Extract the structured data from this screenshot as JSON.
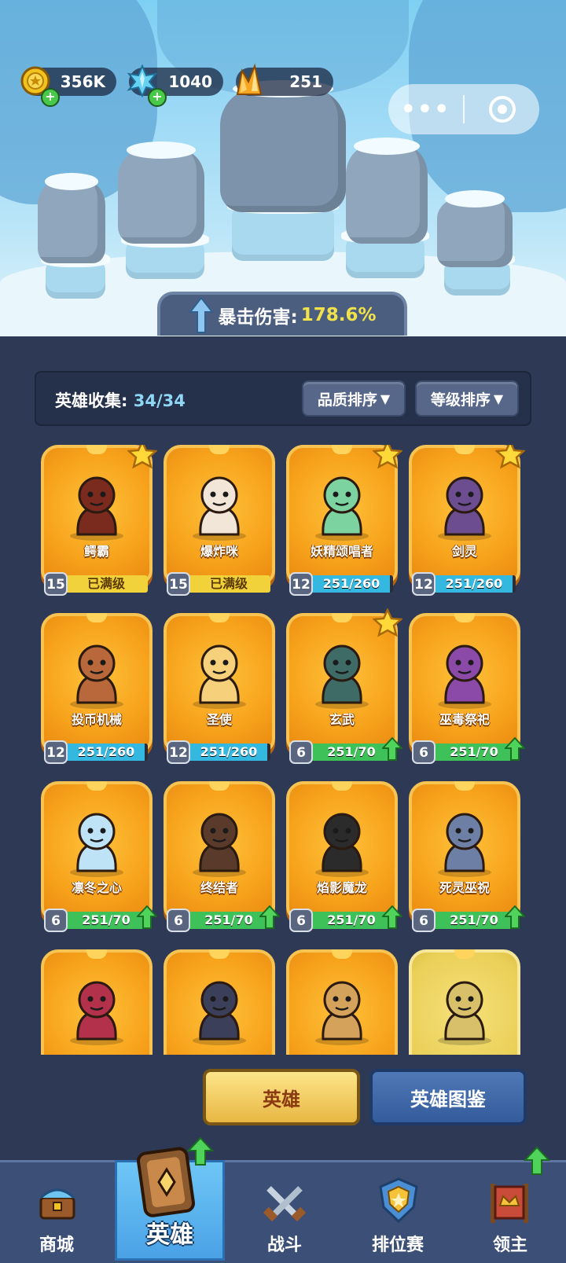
{
  "resources": [
    {
      "icon": "gold-coin-icon",
      "value": "356K"
    },
    {
      "icon": "blue-crystal-icon",
      "value": "1040"
    },
    {
      "icon": "orange-crystal-icon",
      "value": "251"
    }
  ],
  "crit": {
    "label": "暴击伤害:",
    "value": "178.6%"
  },
  "collection": {
    "label": "英雄收集:",
    "value": "34/34"
  },
  "sort": {
    "quality": "品质排序",
    "level": "等级排序"
  },
  "heroes": [
    {
      "name": "鳄霸",
      "level": "15",
      "progress": "已满级",
      "fill": 1.0,
      "maxed": true,
      "star": true,
      "upgrade": false
    },
    {
      "name": "爆炸咪",
      "level": "15",
      "progress": "已满级",
      "fill": 1.0,
      "maxed": true,
      "star": false,
      "upgrade": false
    },
    {
      "name": "妖精颂唱者",
      "level": "12",
      "progress": "251/260",
      "fill": 0.965,
      "maxed": false,
      "star": true,
      "upgrade": false
    },
    {
      "name": "剑灵",
      "level": "12",
      "progress": "251/260",
      "fill": 0.965,
      "maxed": false,
      "star": true,
      "upgrade": false
    },
    {
      "name": "投币机械",
      "level": "12",
      "progress": "251/260",
      "fill": 0.965,
      "maxed": false,
      "star": false,
      "upgrade": false
    },
    {
      "name": "圣使",
      "level": "12",
      "progress": "251/260",
      "fill": 0.965,
      "maxed": false,
      "star": false,
      "upgrade": false
    },
    {
      "name": "玄武",
      "level": "6",
      "progress": "251/70",
      "fill": 1.0,
      "maxed": false,
      "star": true,
      "upgrade": true
    },
    {
      "name": "巫毒祭祀",
      "level": "6",
      "progress": "251/70",
      "fill": 1.0,
      "maxed": false,
      "star": false,
      "upgrade": true
    },
    {
      "name": "凛冬之心",
      "level": "6",
      "progress": "251/70",
      "fill": 1.0,
      "maxed": false,
      "star": false,
      "upgrade": true
    },
    {
      "name": "终结者",
      "level": "6",
      "progress": "251/70",
      "fill": 1.0,
      "maxed": false,
      "star": false,
      "upgrade": true
    },
    {
      "name": "焰影魔龙",
      "level": "6",
      "progress": "251/70",
      "fill": 1.0,
      "maxed": false,
      "star": false,
      "upgrade": true
    },
    {
      "name": "死灵巫祝",
      "level": "6",
      "progress": "251/70",
      "fill": 1.0,
      "maxed": false,
      "star": false,
      "upgrade": true
    },
    {
      "name": "",
      "level": "",
      "progress": "",
      "fill": 0,
      "maxed": false,
      "star": false,
      "upgrade": false
    },
    {
      "name": "",
      "level": "",
      "progress": "",
      "fill": 0,
      "maxed": false,
      "star": false,
      "upgrade": false
    },
    {
      "name": "",
      "level": "",
      "progress": "",
      "fill": 0,
      "maxed": false,
      "star": false,
      "upgrade": false
    },
    {
      "name": "",
      "level": "",
      "progress": "",
      "fill": 0,
      "maxed": false,
      "star": false,
      "upgrade": false
    }
  ],
  "tabs": {
    "heroes": "英雄",
    "codex": "英雄图鉴"
  },
  "nav": [
    {
      "label": "商城",
      "icon": "shop-chest-icon"
    },
    {
      "label": "英雄",
      "icon": "hero-card-icon"
    },
    {
      "label": "战斗",
      "icon": "crossed-swords-icon"
    },
    {
      "label": "排位赛",
      "icon": "rank-shield-icon"
    },
    {
      "label": "领主",
      "icon": "lord-banner-icon"
    }
  ],
  "colors": {
    "card": "#f7a21b",
    "progress_blue": "#35b8e0",
    "progress_green": "#3fc15a",
    "maxed_yellow": "#f2d23a",
    "crit_value": "#f2e24a"
  }
}
